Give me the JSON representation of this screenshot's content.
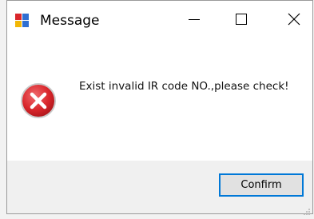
{
  "window": {
    "title": "Message",
    "icon": "app-window-icon"
  },
  "controls": {
    "minimize_icon": "minimize-icon",
    "maximize_icon": "maximize-icon",
    "close_icon": "close-icon"
  },
  "dialog": {
    "icon": "error-icon",
    "message": "Exist invalid IR code NO.,please check!",
    "confirm_label": "Confirm"
  },
  "colors": {
    "error_red": "#d9262b",
    "button_border": "#0078d7"
  }
}
